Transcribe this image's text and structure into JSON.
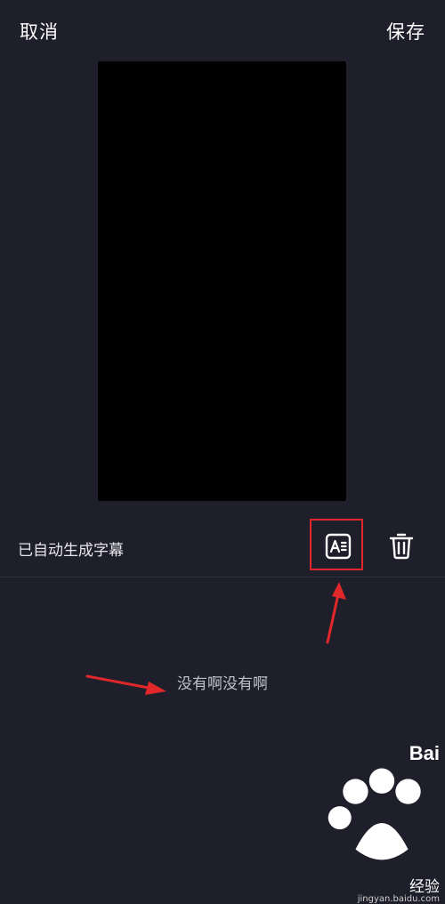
{
  "header": {
    "cancel_label": "取消",
    "save_label": "保存"
  },
  "caption": {
    "status_text": "已自动生成字幕",
    "style_icon": "text-style-icon",
    "delete_icon": "trash-icon"
  },
  "subtitle": {
    "text": "没有啊没有啊"
  },
  "annotations": {
    "color": "#e0272a"
  },
  "watermark": {
    "brand": "Bai",
    "brand_suffix": "经验",
    "url": "jingyan.baidu.com"
  },
  "colors": {
    "background": "#1e1f2a",
    "preview": "#000000",
    "text": "#ffffff"
  }
}
